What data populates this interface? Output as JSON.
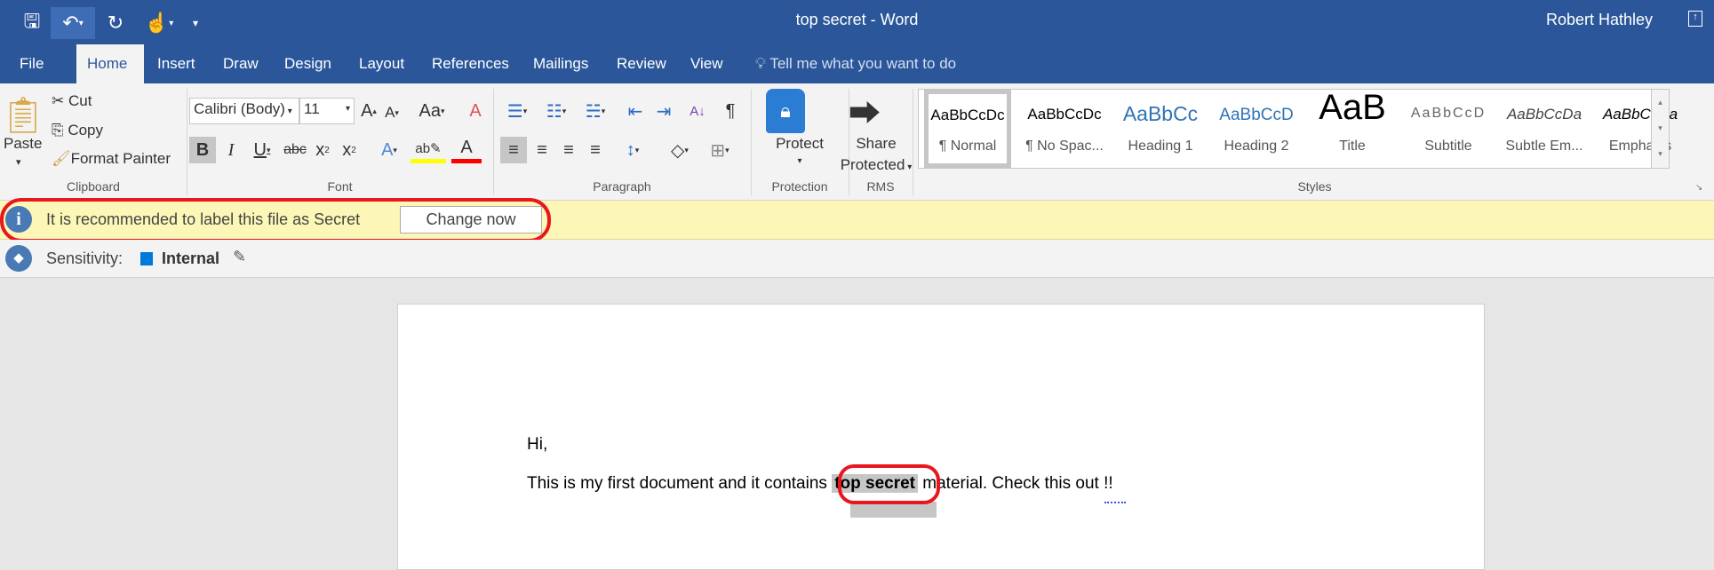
{
  "title_bar": {
    "document_title": "top secret - Word",
    "user_name": "Robert Hathley"
  },
  "tabs": [
    {
      "label": "File"
    },
    {
      "label": "Home"
    },
    {
      "label": "Insert"
    },
    {
      "label": "Draw"
    },
    {
      "label": "Design"
    },
    {
      "label": "Layout"
    },
    {
      "label": "References"
    },
    {
      "label": "Mailings"
    },
    {
      "label": "Review"
    },
    {
      "label": "View"
    }
  ],
  "tell_me": "Tell me what you want to do",
  "clipboard": {
    "paste": "Paste",
    "cut": "Cut",
    "copy": "Copy",
    "format_painter": "Format Painter",
    "label": "Clipboard"
  },
  "font": {
    "name": "Calibri (Body)",
    "size": "11",
    "label": "Font"
  },
  "paragraph": {
    "label": "Paragraph"
  },
  "protection": {
    "button": "Protect",
    "label": "Protection"
  },
  "rms": {
    "button_line1": "Share",
    "button_line2": "Protected",
    "label": "RMS"
  },
  "styles": {
    "label": "Styles",
    "items": [
      {
        "preview": "AaBbCcDc",
        "name": "¶ Normal"
      },
      {
        "preview": "AaBbCcDc",
        "name": "¶ No Spac..."
      },
      {
        "preview": "AaBbCc",
        "name": "Heading 1"
      },
      {
        "preview": "AaBbCcD",
        "name": "Heading 2"
      },
      {
        "preview": "AaB",
        "name": "Title"
      },
      {
        "preview": "AaBbCcD",
        "name": "Subtitle"
      },
      {
        "preview": "AaBbCcDa",
        "name": "Subtle Em..."
      },
      {
        "preview": "AaBbCcDa",
        "name": "Emphasis"
      }
    ]
  },
  "message_bar": {
    "text": "It is recommended to label this file as Secret",
    "button": "Change now"
  },
  "sensitivity": {
    "label": "Sensitivity:",
    "value": "Internal",
    "color": "#0078d7"
  },
  "document": {
    "line1": "Hi,",
    "line2_before": "This is my first document and it contains ",
    "line2_highlight": "top secret",
    "line2_after": " material. Check this out !!"
  }
}
